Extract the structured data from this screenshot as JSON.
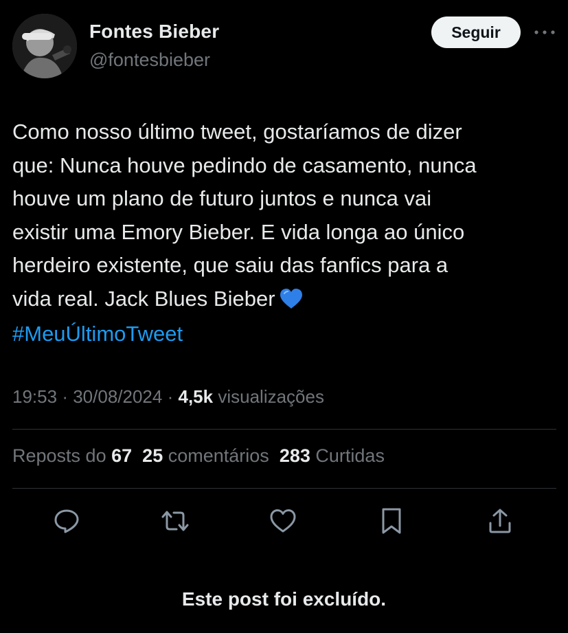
{
  "header": {
    "display_name": "Fontes Bieber",
    "handle": "@fontesbieber",
    "follow_label": "Seguir",
    "avatar_icon": "profile-photo",
    "more_icon": "more-horizontal-icon"
  },
  "tweet": {
    "text": "Como nosso último tweet, gostaríamos de dizer\nque: Nunca houve pedindo de casamento, nunca\nhouve um plano de futuro juntos e nunca vai\nexistir uma Emory Bieber. E vida longa ao único\nherdeiro existente, que saiu das fanfics para a\nvida real. Jack Blues Bieber",
    "emoji": "blue-heart",
    "hashtag": "#MeuÚltimoTweet",
    "hashtag_color": "#1d9bf0"
  },
  "meta": {
    "time": "19:53",
    "separator": "·",
    "date": "30/08/2024",
    "views_count": "4,5k",
    "views_label": "visualizações"
  },
  "stats": {
    "reposts_label": "Reposts do",
    "reposts_count": "67",
    "comments_count": "25",
    "comments_label": "comentários",
    "likes_count": "283",
    "likes_label": "Curtidas"
  },
  "actions": [
    {
      "icon": "reply-icon"
    },
    {
      "icon": "repost-icon"
    },
    {
      "icon": "like-icon"
    },
    {
      "icon": "bookmark-icon"
    },
    {
      "icon": "share-icon"
    }
  ],
  "footer": {
    "deleted_notice": "Este post foi excluído."
  },
  "colors": {
    "background": "#000000",
    "text": "#e7e9ea",
    "muted": "#71767b",
    "divider": "#2f3336",
    "accent": "#1d9bf0"
  }
}
